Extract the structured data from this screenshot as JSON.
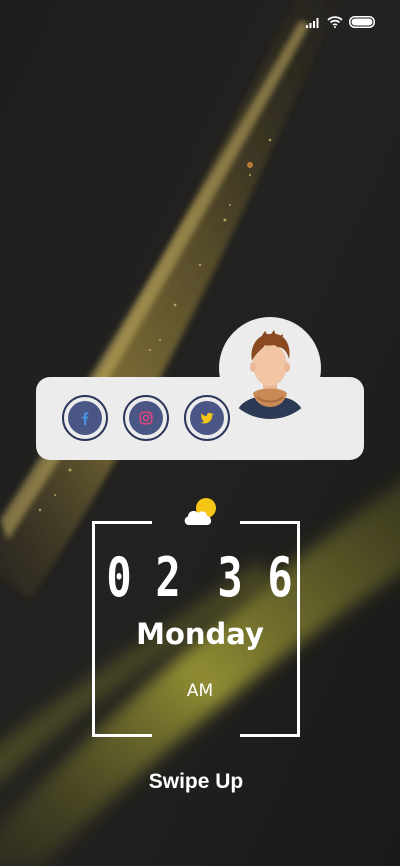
{
  "status_bar": {
    "icons": [
      "signal-icon",
      "wifi-icon",
      "battery-icon"
    ]
  },
  "profile": {
    "avatar": "man-with-scarf-avatar",
    "social_links": [
      {
        "name": "facebook",
        "icon": "facebook-icon",
        "glyph_color": "#4a90e2"
      },
      {
        "name": "instagram",
        "icon": "instagram-icon",
        "glyph_color": "#e0457b"
      },
      {
        "name": "twitter",
        "icon": "twitter-icon",
        "glyph_color": "#f5c518"
      }
    ]
  },
  "clock": {
    "weather_icon": "partly-cloudy-icon",
    "digits": [
      "0",
      "2",
      "3",
      "6"
    ],
    "day": "Monday",
    "period": "AM"
  },
  "lockscreen": {
    "swipe_label": "Swipe Up"
  },
  "colors": {
    "background": "#1c1c1a",
    "card": "#ececec",
    "social_ring": "#2c355a",
    "social_fill": "#4a5685",
    "sun": "#f5c518",
    "text": "#ffffff"
  }
}
